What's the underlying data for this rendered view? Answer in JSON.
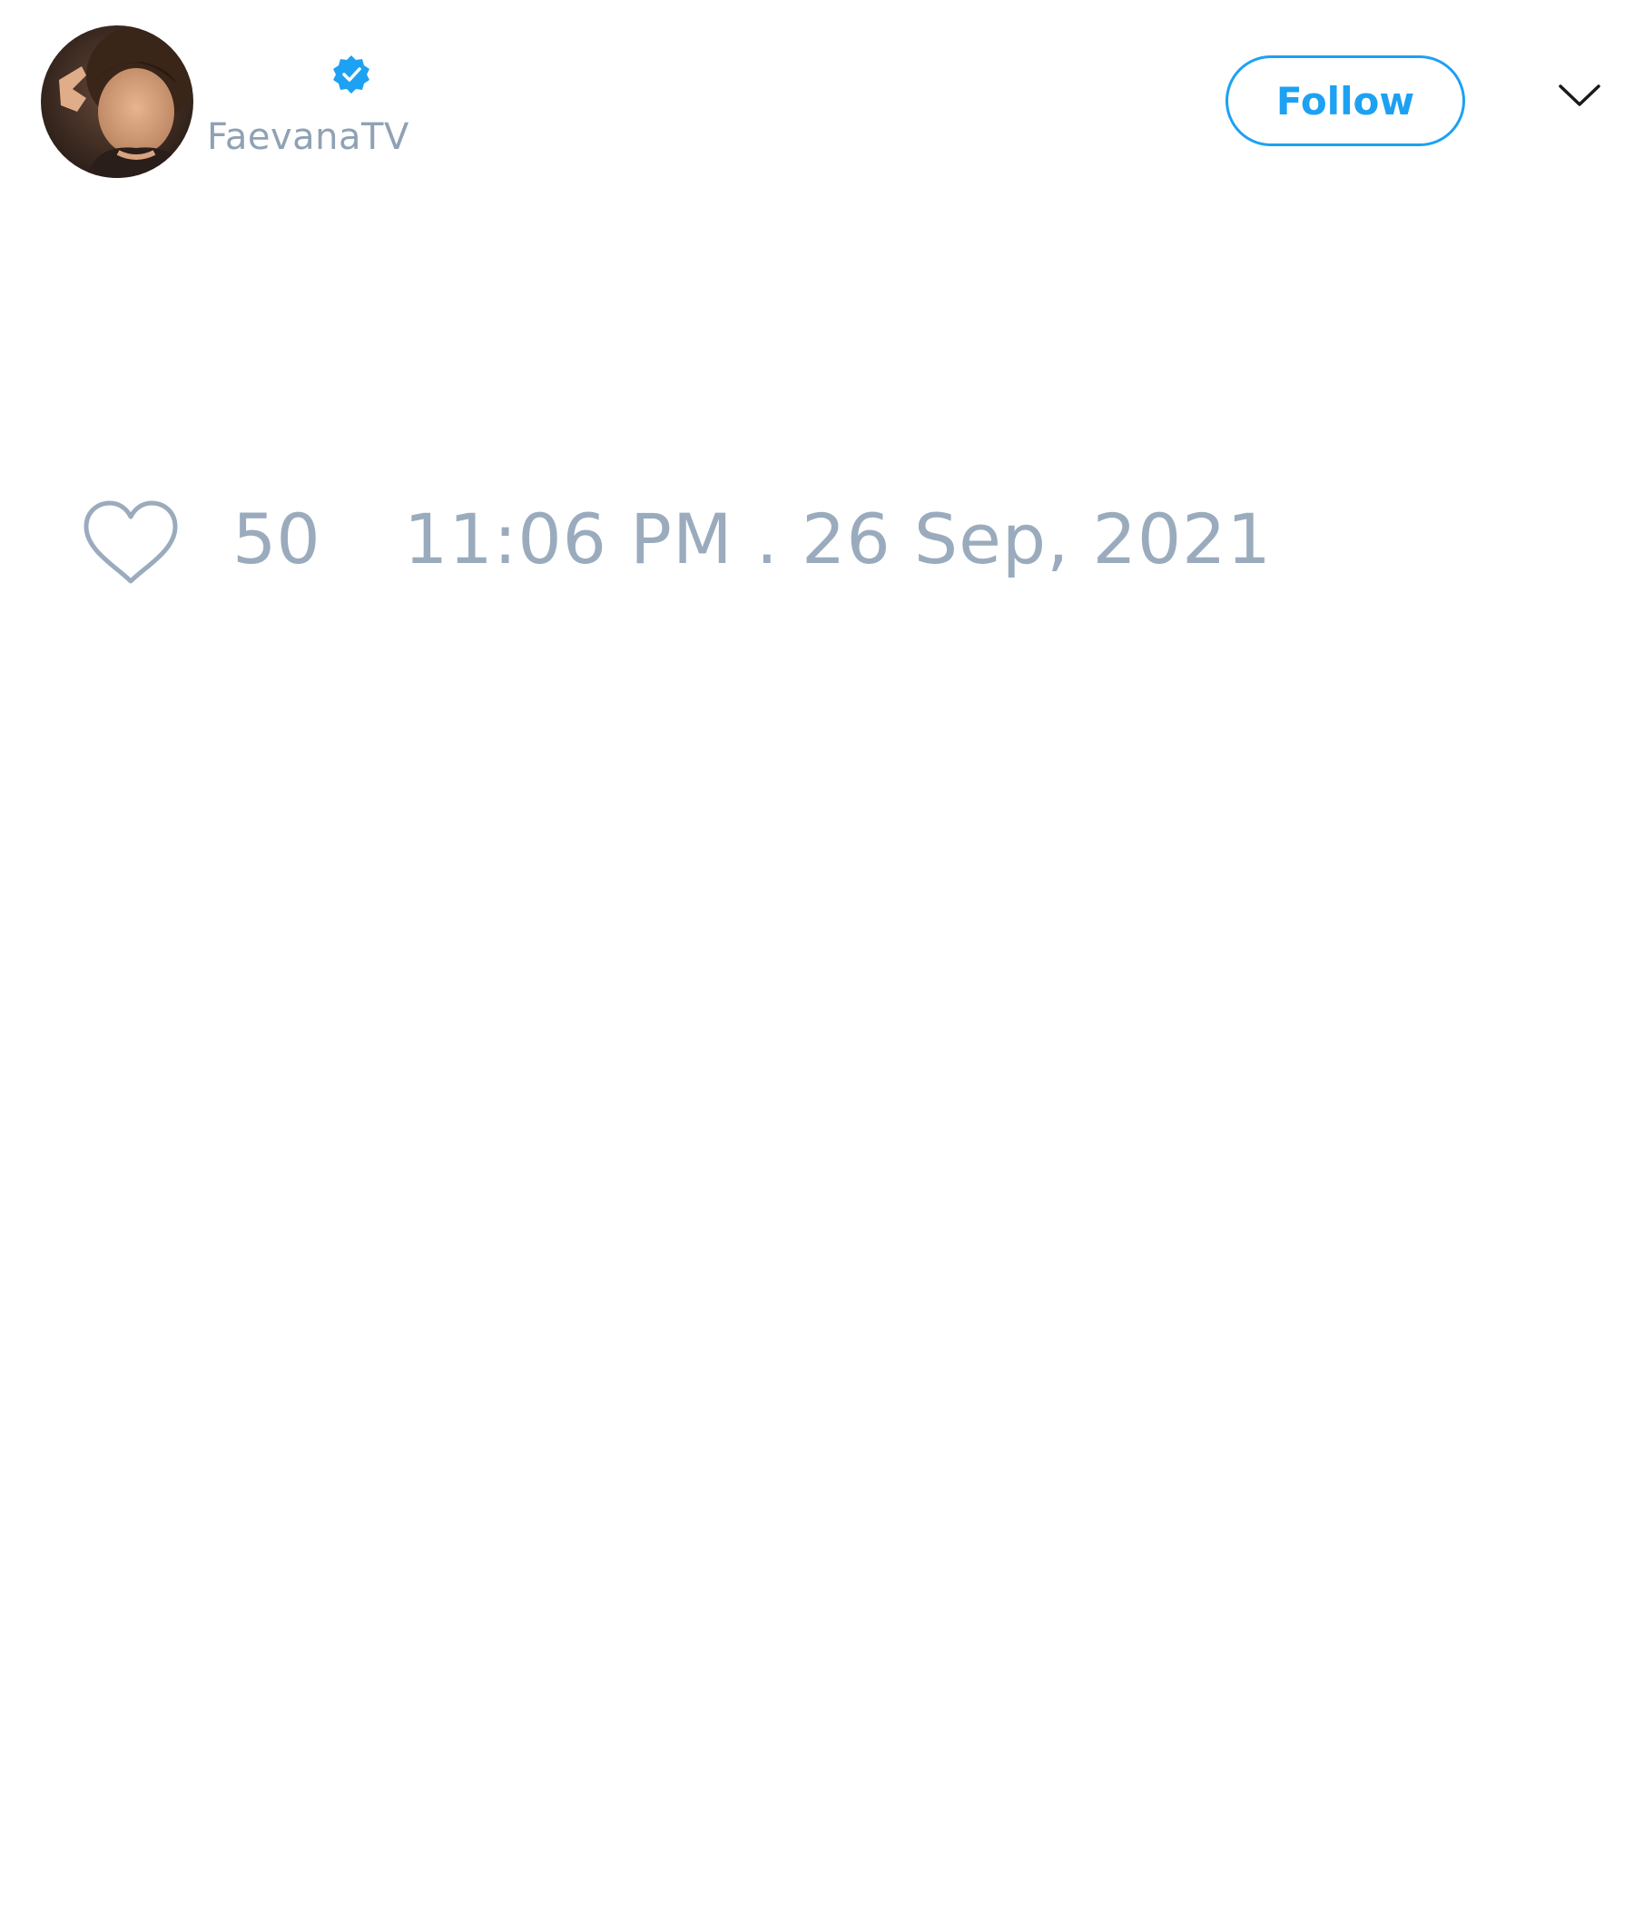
{
  "user": {
    "display_name": "",
    "handle": "FaevanaTV",
    "verified": true,
    "avatar_icon": "profile-photo"
  },
  "actions": {
    "follow_label": "Follow",
    "menu_icon": "chevron-down-icon"
  },
  "tweet": {
    "text": "",
    "like_count": "50",
    "timestamp": "11:06 PM . 26 Sep, 2021"
  },
  "colors": {
    "accent": "#1da1f2",
    "muted_text": "#9aabbd",
    "background": "#ffffff"
  }
}
